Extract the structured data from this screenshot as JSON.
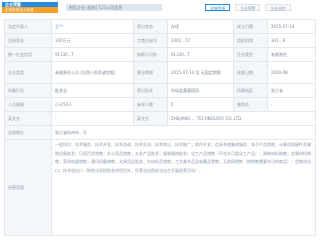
{
  "header": {
    "logo_top": "企业预警",
    "logo_bottom": "企查查的企业信息",
    "title": "附近企业 (相关) 123公司信息",
    "tabs": [
      "全部信息",
      "企业预警",
      "企业风控"
    ]
  },
  "table": {
    "rows": [
      {
        "cells": [
          {
            "t": "l",
            "w": "l1",
            "v": "法定代表人"
          },
          {
            "t": "v",
            "w": "v1",
            "v": "王**",
            "blue": true
          },
          {
            "t": "l",
            "w": "l2",
            "v": "登记状态"
          },
          {
            "t": "v",
            "w": "v2",
            "v": "存续"
          },
          {
            "t": "l",
            "w": "l3",
            "v": "成立日期"
          },
          {
            "t": "v",
            "w": "v3",
            "v": "2015-07-14"
          }
        ],
        "h": 14
      },
      {
        "cells": [
          {
            "t": "l",
            "w": "l1",
            "v": "注册资本"
          },
          {
            "t": "v",
            "w": "v1",
            "v": "100万元"
          },
          {
            "t": "l",
            "w": "l2",
            "v": "工商注册号"
          },
          {
            "t": "v",
            "w": "v2",
            "v": "3301...72"
          },
          {
            "t": "l",
            "w": "l3",
            "v": "组织机构"
          },
          {
            "t": "v",
            "w": "v3",
            "v": "341...9"
          }
        ],
        "h": 14
      },
      {
        "cells": [
          {
            "t": "l",
            "w": "l1",
            "v": "统一社会信用"
          },
          {
            "t": "v",
            "w": "v1",
            "v": "91330...T"
          },
          {
            "t": "l",
            "w": "l2",
            "v": "纳税人识别"
          },
          {
            "t": "v",
            "w": "v2",
            "v": "91330...T"
          },
          {
            "t": "l",
            "w": "l3",
            "v": "企业类型"
          },
          {
            "t": "v",
            "w": "v3",
            "v": "有限责任"
          }
        ],
        "h": 14
      },
      {
        "cells": [
          {
            "t": "l",
            "w": "l1",
            "v": "企业类型"
          },
          {
            "t": "v",
            "w": "v1",
            "v": "有限责任公司 (自然人投资或控股)"
          },
          {
            "t": "l",
            "w": "l2",
            "v": "营业期限"
          },
          {
            "t": "v",
            "w": "v2",
            "v": "2015-07-14 至 无固定期限"
          },
          {
            "t": "l",
            "w": "l3",
            "v": "核准日期"
          },
          {
            "t": "v",
            "w": "v3",
            "v": "2020-08"
          }
        ],
        "h": 22
      },
      {
        "cells": [
          {
            "t": "l",
            "w": "l1",
            "v": "所属行业"
          },
          {
            "t": "v",
            "w": "v1",
            "v": "批发业"
          },
          {
            "t": "l",
            "w": "l2",
            "v": "登记机关"
          },
          {
            "t": "v",
            "w": "v2",
            "v": "市场监督管理局"
          },
          {
            "t": "l",
            "w": "l3",
            "v": "所属地区"
          },
          {
            "t": "v",
            "w": "v3",
            "v": "浙江省"
          }
        ],
        "h": 14
      },
      {
        "cells": [
          {
            "t": "l",
            "w": "l1",
            "v": "人员规模"
          },
          {
            "t": "v",
            "w": "v1",
            "v": "小于50人"
          },
          {
            "t": "l",
            "w": "l2",
            "v": "参保人数"
          },
          {
            "t": "v",
            "w": "v2",
            "v": "0"
          },
          {
            "t": "l",
            "w": "l3",
            "v": "曾用名"
          },
          {
            "t": "v",
            "w": "v3",
            "v": "-"
          }
        ],
        "h": 14
      },
      {
        "cells": [
          {
            "t": "l",
            "w": "l1",
            "v": "英文名"
          },
          {
            "t": "v",
            "w": "v1",
            "v": "-"
          },
          {
            "t": "l",
            "w": "l2",
            "v": "英文名"
          },
          {
            "t": "v",
            "w": "v2",
            "v": "ZHEJIANG ... TECHNOLOGY CO.,LTD.",
            "span": 3
          }
        ],
        "h": 14
      },
      {
        "cells": [
          {
            "t": "l",
            "w": "l1",
            "v": "注册地址"
          },
          {
            "t": "v",
            "w": "v1",
            "v": "浙江省杭州市...号",
            "span": 5
          }
        ],
        "h": 14
      }
    ],
    "scope_label": "经营范围",
    "scope_text": "一般项目：技术服务、技术开发、技术咨询、技术交流、技术转让、技术推广；软件开发；信息系统集成服务；电子产品销售；计算机软硬件及辅助设备批发；日用百货销售；办公用品销售；五金产品批发；服装服饰批发；化工产品销售（不含许可类化工产品）；建筑材料销售；金属材料销售；家用电器销售；通讯设备销售；文具用品批发；针纺织品销售；工艺美术品及收藏品零售；互联网销售（除销售需要许可的商品）；货物进出口；技术进出口（除依法须经批准的项目外，凭营业执照依法自主开展经营活动）。"
  },
  "colors": {
    "accent": "#2a8cd9",
    "brand_orange": "#f6a02a",
    "label_bg": "#f4f7fa",
    "border": "#e3e8ee"
  }
}
